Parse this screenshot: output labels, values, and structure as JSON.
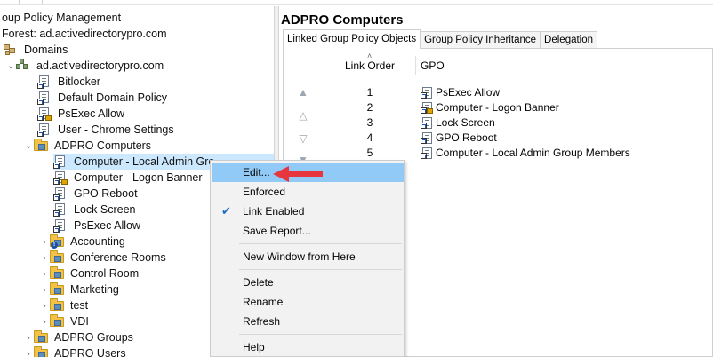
{
  "window": {
    "app_title": "oup Policy Management"
  },
  "tree": {
    "forest_label": "Forest: ad.activedirectorypro.com",
    "domains_label": "Domains",
    "domain_label": "ad.activedirectorypro.com",
    "domain_links": [
      {
        "label": "Bitlocker",
        "icon": "gpo-link-icon"
      },
      {
        "label": "Default Domain Policy",
        "icon": "gpo-link-icon"
      },
      {
        "label": "PsExec Allow",
        "icon": "gpo-link-lock-icon"
      },
      {
        "label": "User - Chrome Settings",
        "icon": "gpo-link-icon"
      }
    ],
    "ou_label": "ADPRO Computers",
    "ou_children": [
      {
        "label": "Computer - Local Admin Gro",
        "icon": "gpo-link-icon",
        "selected": true
      },
      {
        "label": "Computer - Logon Banner",
        "icon": "gpo-link-lock-icon"
      },
      {
        "label": "GPO Reboot",
        "icon": "gpo-link-icon"
      },
      {
        "label": "Lock Screen",
        "icon": "gpo-link-icon"
      },
      {
        "label": "PsExec Allow",
        "icon": "gpo-link-icon"
      }
    ],
    "sub_ous": [
      {
        "label": "Accounting",
        "icon": "ou-warning-icon"
      },
      {
        "label": "Conference Rooms",
        "icon": "folder-icon"
      },
      {
        "label": "Control Room",
        "icon": "folder-icon"
      },
      {
        "label": "Marketing",
        "icon": "folder-icon"
      },
      {
        "label": "test",
        "icon": "folder-icon"
      },
      {
        "label": "VDI",
        "icon": "folder-icon"
      }
    ],
    "sibling_ous": [
      {
        "label": "ADPRO Groups"
      },
      {
        "label": "ADPRO Users"
      }
    ]
  },
  "right_pane": {
    "title": "ADPRO Computers",
    "tabs": [
      {
        "label": "Linked Group Policy Objects",
        "active": true
      },
      {
        "label": "Group Policy Inheritance",
        "active": false
      },
      {
        "label": "Delegation",
        "active": false
      }
    ],
    "columns": {
      "link_order": "Link Order",
      "gpo": "GPO"
    },
    "rows": [
      {
        "order": "1",
        "gpo": "PsExec Allow",
        "icon": "gpo-link-icon"
      },
      {
        "order": "2",
        "gpo": "Computer - Logon Banner",
        "icon": "gpo-link-lock-icon"
      },
      {
        "order": "3",
        "gpo": "Lock Screen",
        "icon": "gpo-link-icon"
      },
      {
        "order": "4",
        "gpo": "GPO Reboot",
        "icon": "gpo-link-icon"
      },
      {
        "order": "5",
        "gpo": "Computer - Local Admin Group Members",
        "icon": "gpo-link-icon"
      }
    ]
  },
  "context_menu": {
    "items": [
      {
        "label": "Edit...",
        "highlighted": true
      },
      {
        "label": "Enforced"
      },
      {
        "label": "Link Enabled",
        "checked": true
      },
      {
        "label": "Save Report..."
      },
      {
        "label": "New Window from Here"
      },
      {
        "label": "Delete"
      },
      {
        "label": "Rename"
      },
      {
        "label": "Refresh"
      },
      {
        "label": "Help"
      }
    ]
  },
  "colors": {
    "selection": "#cce8ff",
    "menu_highlight": "#91c9f7",
    "annotation_arrow": "#e8363f",
    "folder": "#f1c24a"
  }
}
